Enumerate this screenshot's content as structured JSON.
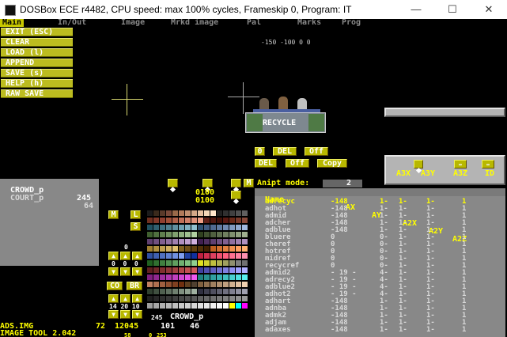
{
  "window": {
    "title": "DOSBox ECE r4482, CPU speed: max 100% cycles, Frameskip  0, Program:       IT",
    "minimize": "—",
    "maximize": "☐",
    "close": "✕"
  },
  "menu": {
    "main": "Main",
    "inout": "In/Out",
    "image": "Image",
    "mrkd_image": "Mrkd image",
    "pal": "Pal",
    "marks": "Marks",
    "prog": "Prog"
  },
  "main_menu": {
    "exit": "EXIT (ESC)",
    "clear": "CLEAR",
    "load": "LOAD (l)",
    "append": "APPEND",
    "save": "SAVE (s)",
    "help": "HELP (h)",
    "raw_save": "RAW SAVE"
  },
  "coords": "-150 -100 0 0",
  "sprite": {
    "sign": "RECYCLE"
  },
  "controls": {
    "zero": "0",
    "del1": "DEL",
    "off1": "Off",
    "del2": "DEL",
    "off2": "Off",
    "copy": "Copy"
  },
  "axis_panel": {
    "a3x": "A3X",
    "a3y": "A3Y",
    "a3z": "A3Z",
    "id": "ID"
  },
  "files": [
    {
      "name": "CROWD_p",
      "count": "245"
    },
    {
      "name": "COURT_p",
      "count": "64"
    }
  ],
  "anim_values": [
    "0100",
    "0100"
  ],
  "anipt": {
    "label": "Anipt mode:",
    "value": "2"
  },
  "m_label": "M",
  "table": {
    "headers": {
      "name": "Name",
      "ax": "AX",
      "ay": "AY",
      "a2x": "A2X",
      "a2y": "A2Y",
      "a2z": "A2Z"
    },
    "rows": [
      {
        "name": "adrecyc",
        "ax": "-148",
        "ay": "1-",
        "a2x": "1-",
        "a2y": "1-",
        "a2z": "1",
        "selected": true
      },
      {
        "name": "adhot",
        "ax": "-148",
        "ay": "1-",
        "a2x": "1-",
        "a2y": "1-",
        "a2z": "1"
      },
      {
        "name": "admid",
        "ax": "-148",
        "ay": "1-",
        "a2x": "1-",
        "a2y": "1-",
        "a2z": "1"
      },
      {
        "name": "adcher",
        "ax": "-148",
        "ay": "1-",
        "a2x": "1-",
        "a2y": "1-",
        "a2z": "1"
      },
      {
        "name": "adblue",
        "ax": "-148",
        "ay": "1-",
        "a2x": "1-",
        "a2y": "1-",
        "a2z": "1"
      },
      {
        "name": "bluere",
        "ax": "0",
        "ay": "0-",
        "a2x": "1-",
        "a2y": "1-",
        "a2z": "1"
      },
      {
        "name": "cheref",
        "ax": "0",
        "ay": "0-",
        "a2x": "1-",
        "a2y": "1-",
        "a2z": "1"
      },
      {
        "name": "hotref",
        "ax": "0",
        "ay": "0-",
        "a2x": "1-",
        "a2y": "1-",
        "a2z": "1"
      },
      {
        "name": "midref",
        "ax": "0",
        "ay": "0-",
        "a2x": "1-",
        "a2y": "1-",
        "a2z": "1"
      },
      {
        "name": "recycref",
        "ax": "0",
        "ay": "0-",
        "a2x": "1-",
        "a2y": "1-",
        "a2z": "1"
      },
      {
        "name": "admid2",
        "ax": "- 19 -",
        "ay": "4-",
        "a2x": "1-",
        "a2y": "1-",
        "a2z": "1"
      },
      {
        "name": "adrecy2",
        "ax": "- 19 -",
        "ay": "4-",
        "a2x": "1-",
        "a2y": "1-",
        "a2z": "1"
      },
      {
        "name": "adblue2",
        "ax": "- 19 -",
        "ay": "4-",
        "a2x": "1-",
        "a2y": "1-",
        "a2z": "1"
      },
      {
        "name": "adhot2",
        "ax": "- 19 -",
        "ay": "4-",
        "a2x": "1-",
        "a2y": "1-",
        "a2z": "1"
      },
      {
        "name": "adhart",
        "ax": "-148",
        "ay": "1-",
        "a2x": "1-",
        "a2y": "1-",
        "a2z": "1"
      },
      {
        "name": "adnba",
        "ax": "-148",
        "ay": "1-",
        "a2x": "1-",
        "a2y": "1-",
        "a2z": "1"
      },
      {
        "name": "admk2",
        "ax": "-148",
        "ay": "1-",
        "a2x": "1-",
        "a2y": "1-",
        "a2z": "1"
      },
      {
        "name": "adjam",
        "ax": "-148",
        "ay": "1-",
        "a2x": "1-",
        "a2y": "1-",
        "a2z": "1"
      },
      {
        "name": "adaxes",
        "ax": "-148",
        "ay": "1-",
        "a2x": "1-",
        "a2y": "1-",
        "a2z": "1"
      }
    ]
  },
  "pal_buttons": {
    "m": "M",
    "l": "L",
    "s": "S",
    "co": "CO",
    "br": "BR"
  },
  "pal_numbers": {
    "a": "0",
    "b": "0  0  0",
    "c": "14 20 10",
    "d": "245",
    "e": "CROWD_p"
  },
  "status": {
    "file": "ADS.IMG",
    "n1": "72",
    "n2": "12045",
    "n3": "101",
    "n4": "46",
    "tool": "IMAGE TOOL 2.042",
    "n5": "58",
    "n6": "0",
    "n7": "253"
  },
  "colors": {
    "accent": "#bcbc20",
    "panel": "#b4b4b4",
    "list": "#888888",
    "highlight": "#ffff00"
  }
}
